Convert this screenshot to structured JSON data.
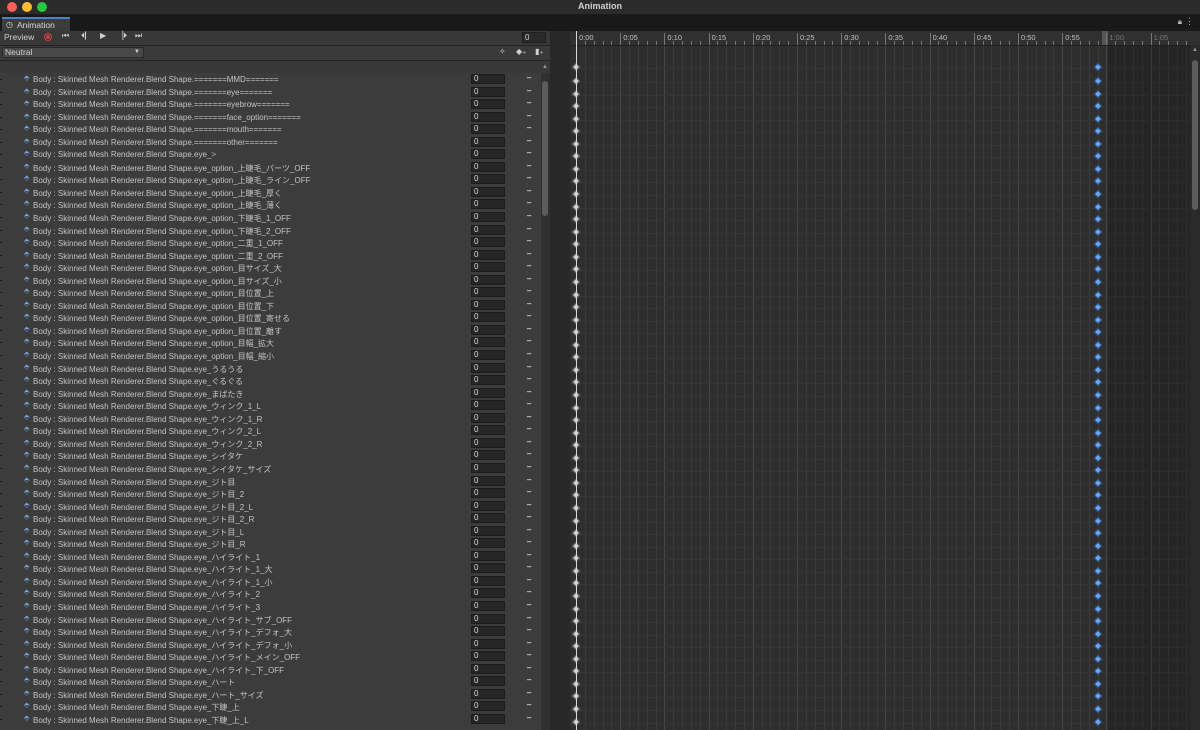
{
  "window": {
    "title": "Animation"
  },
  "tab": {
    "label": "Animation",
    "icon": "animation-clock-icon"
  },
  "toolbar": {
    "preview_label": "Preview",
    "frame_value": "0",
    "buttons": [
      "record-button",
      "first-key-button",
      "prev-key-button",
      "play-button",
      "next-key-button",
      "last-key-button"
    ]
  },
  "clip": {
    "selected": "Neutral",
    "buttons": [
      "add-keyframe-button",
      "add-event-button",
      "filter-button"
    ]
  },
  "timeline": {
    "labels": [
      "0:00",
      "0:05",
      "0:10",
      "0:15",
      "0:20",
      "0:25",
      "0:30",
      "0:35",
      "0:40",
      "0:45",
      "0:50",
      "0:55",
      "1:00",
      "1:05"
    ],
    "label_dim_from": 12
  },
  "properties": [
    {
      "label": "Body : Skinned Mesh Renderer.Blend Shape.=======MMD=======",
      "value": "0"
    },
    {
      "label": "Body : Skinned Mesh Renderer.Blend Shape.=======eye=======",
      "value": "0"
    },
    {
      "label": "Body : Skinned Mesh Renderer.Blend Shape.=======eyebrow=======",
      "value": "0"
    },
    {
      "label": "Body : Skinned Mesh Renderer.Blend Shape.=======face_option=======",
      "value": "0"
    },
    {
      "label": "Body : Skinned Mesh Renderer.Blend Shape.=======mouth=======",
      "value": "0"
    },
    {
      "label": "Body : Skinned Mesh Renderer.Blend Shape.=======other=======",
      "value": "0"
    },
    {
      "label": "Body : Skinned Mesh Renderer.Blend Shape.eye_>",
      "value": "0"
    },
    {
      "label": "Body : Skinned Mesh Renderer.Blend Shape.eye_option_上睫毛_パーツ_OFF",
      "value": "0"
    },
    {
      "label": "Body : Skinned Mesh Renderer.Blend Shape.eye_option_上睫毛_ライン_OFF",
      "value": "0"
    },
    {
      "label": "Body : Skinned Mesh Renderer.Blend Shape.eye_option_上睫毛_厚く",
      "value": "0"
    },
    {
      "label": "Body : Skinned Mesh Renderer.Blend Shape.eye_option_上睫毛_薄く",
      "value": "0"
    },
    {
      "label": "Body : Skinned Mesh Renderer.Blend Shape.eye_option_下睫毛_1_OFF",
      "value": "0"
    },
    {
      "label": "Body : Skinned Mesh Renderer.Blend Shape.eye_option_下睫毛_2_OFF",
      "value": "0"
    },
    {
      "label": "Body : Skinned Mesh Renderer.Blend Shape.eye_option_二重_1_OFF",
      "value": "0"
    },
    {
      "label": "Body : Skinned Mesh Renderer.Blend Shape.eye_option_二重_2_OFF",
      "value": "0"
    },
    {
      "label": "Body : Skinned Mesh Renderer.Blend Shape.eye_option_目サイズ_大",
      "value": "0"
    },
    {
      "label": "Body : Skinned Mesh Renderer.Blend Shape.eye_option_目サイズ_小",
      "value": "0"
    },
    {
      "label": "Body : Skinned Mesh Renderer.Blend Shape.eye_option_目位置_上",
      "value": "0"
    },
    {
      "label": "Body : Skinned Mesh Renderer.Blend Shape.eye_option_目位置_下",
      "value": "0"
    },
    {
      "label": "Body : Skinned Mesh Renderer.Blend Shape.eye_option_目位置_寄せる",
      "value": "0"
    },
    {
      "label": "Body : Skinned Mesh Renderer.Blend Shape.eye_option_目位置_離す",
      "value": "0"
    },
    {
      "label": "Body : Skinned Mesh Renderer.Blend Shape.eye_option_目幅_拡大",
      "value": "0"
    },
    {
      "label": "Body : Skinned Mesh Renderer.Blend Shape.eye_option_目幅_縮小",
      "value": "0"
    },
    {
      "label": "Body : Skinned Mesh Renderer.Blend Shape.eye_うるうる",
      "value": "0"
    },
    {
      "label": "Body : Skinned Mesh Renderer.Blend Shape.eye_ぐるぐる",
      "value": "0"
    },
    {
      "label": "Body : Skinned Mesh Renderer.Blend Shape.eye_まばたき",
      "value": "0"
    },
    {
      "label": "Body : Skinned Mesh Renderer.Blend Shape.eye_ウィンク_1_L",
      "value": "0"
    },
    {
      "label": "Body : Skinned Mesh Renderer.Blend Shape.eye_ウィンク_1_R",
      "value": "0"
    },
    {
      "label": "Body : Skinned Mesh Renderer.Blend Shape.eye_ウィンク_2_L",
      "value": "0"
    },
    {
      "label": "Body : Skinned Mesh Renderer.Blend Shape.eye_ウィンク_2_R",
      "value": "0"
    },
    {
      "label": "Body : Skinned Mesh Renderer.Blend Shape.eye_シイタケ",
      "value": "0"
    },
    {
      "label": "Body : Skinned Mesh Renderer.Blend Shape.eye_シイタケ_サイズ",
      "value": "0"
    },
    {
      "label": "Body : Skinned Mesh Renderer.Blend Shape.eye_ジト目",
      "value": "0"
    },
    {
      "label": "Body : Skinned Mesh Renderer.Blend Shape.eye_ジト目_2",
      "value": "0"
    },
    {
      "label": "Body : Skinned Mesh Renderer.Blend Shape.eye_ジト目_2_L",
      "value": "0"
    },
    {
      "label": "Body : Skinned Mesh Renderer.Blend Shape.eye_ジト目_2_R",
      "value": "0"
    },
    {
      "label": "Body : Skinned Mesh Renderer.Blend Shape.eye_ジト目_L",
      "value": "0"
    },
    {
      "label": "Body : Skinned Mesh Renderer.Blend Shape.eye_ジト目_R",
      "value": "0"
    },
    {
      "label": "Body : Skinned Mesh Renderer.Blend Shape.eye_ハイライト_1",
      "value": "0"
    },
    {
      "label": "Body : Skinned Mesh Renderer.Blend Shape.eye_ハイライト_1_大",
      "value": "0"
    },
    {
      "label": "Body : Skinned Mesh Renderer.Blend Shape.eye_ハイライト_1_小",
      "value": "0"
    },
    {
      "label": "Body : Skinned Mesh Renderer.Blend Shape.eye_ハイライト_2",
      "value": "0"
    },
    {
      "label": "Body : Skinned Mesh Renderer.Blend Shape.eye_ハイライト_3",
      "value": "0"
    },
    {
      "label": "Body : Skinned Mesh Renderer.Blend Shape.eye_ハイライト_サブ_OFF",
      "value": "0"
    },
    {
      "label": "Body : Skinned Mesh Renderer.Blend Shape.eye_ハイライト_デフォ_大",
      "value": "0"
    },
    {
      "label": "Body : Skinned Mesh Renderer.Blend Shape.eye_ハイライト_デフォ_小",
      "value": "0"
    },
    {
      "label": "Body : Skinned Mesh Renderer.Blend Shape.eye_ハイライト_メイン_OFF",
      "value": "0"
    },
    {
      "label": "Body : Skinned Mesh Renderer.Blend Shape.eye_ハイライト_下_OFF",
      "value": "0"
    },
    {
      "label": "Body : Skinned Mesh Renderer.Blend Shape.eye_ハート",
      "value": "0"
    },
    {
      "label": "Body : Skinned Mesh Renderer.Blend Shape.eye_ハート_サイズ",
      "value": "0"
    },
    {
      "label": "Body : Skinned Mesh Renderer.Blend Shape.eye_下睫_上",
      "value": "0"
    },
    {
      "label": "Body : Skinned Mesh Renderer.Blend Shape.eye_下睫_上_L",
      "value": "0"
    }
  ],
  "colors": {
    "accent": "#4a7fd6",
    "key_start": "#d0d0d0",
    "key_end": "#6fa6ee",
    "record": "#d04040"
  }
}
